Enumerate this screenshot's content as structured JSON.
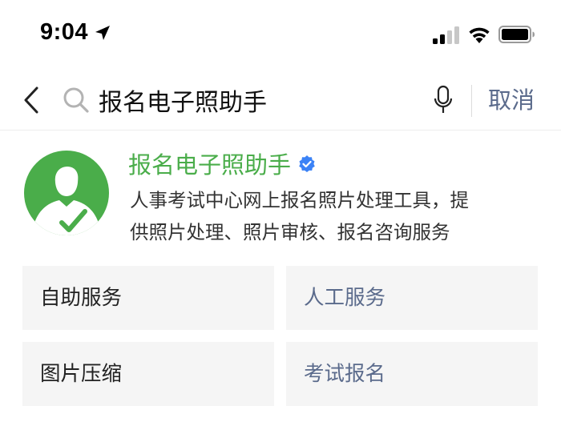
{
  "status_bar": {
    "time": "9:04",
    "icons": [
      "location-arrow-icon",
      "signal-icon",
      "wifi-icon",
      "battery-icon"
    ]
  },
  "search": {
    "query": "报名电子照助手",
    "cancel_label": "取消",
    "icons": [
      "back-chevron-icon",
      "search-icon",
      "microphone-icon"
    ]
  },
  "account": {
    "name": "报名电子照助手",
    "verified": true,
    "description_line1": "人事考试中心网上报名照片处理工具，提",
    "description_line2": "供照片处理、照片审核、报名咨询服务",
    "avatar_icon": "person-checkmark-icon"
  },
  "services": [
    {
      "label": "自助服务"
    },
    {
      "label": "人工服务"
    },
    {
      "label": "图片压缩"
    },
    {
      "label": "考试报名"
    }
  ],
  "colors": {
    "brand_green": "#4aad4a",
    "verified_blue": "#3b82f6",
    "link_gray_blue": "#5b6b8c",
    "tile_bg": "#f5f5f5"
  }
}
